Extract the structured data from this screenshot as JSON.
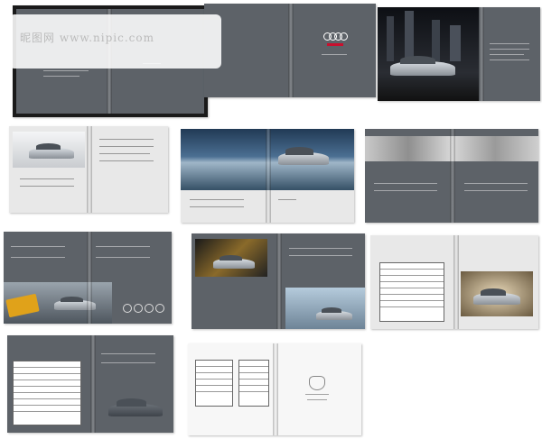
{
  "cover": {
    "logo": "audi-rings-logo"
  },
  "colors": {
    "page_gray": "#5d6268",
    "light_page": "#e8e8e8",
    "frame": "#1a1a1a"
  },
  "watermark": {
    "text": "昵图网 www.nipic.com"
  }
}
